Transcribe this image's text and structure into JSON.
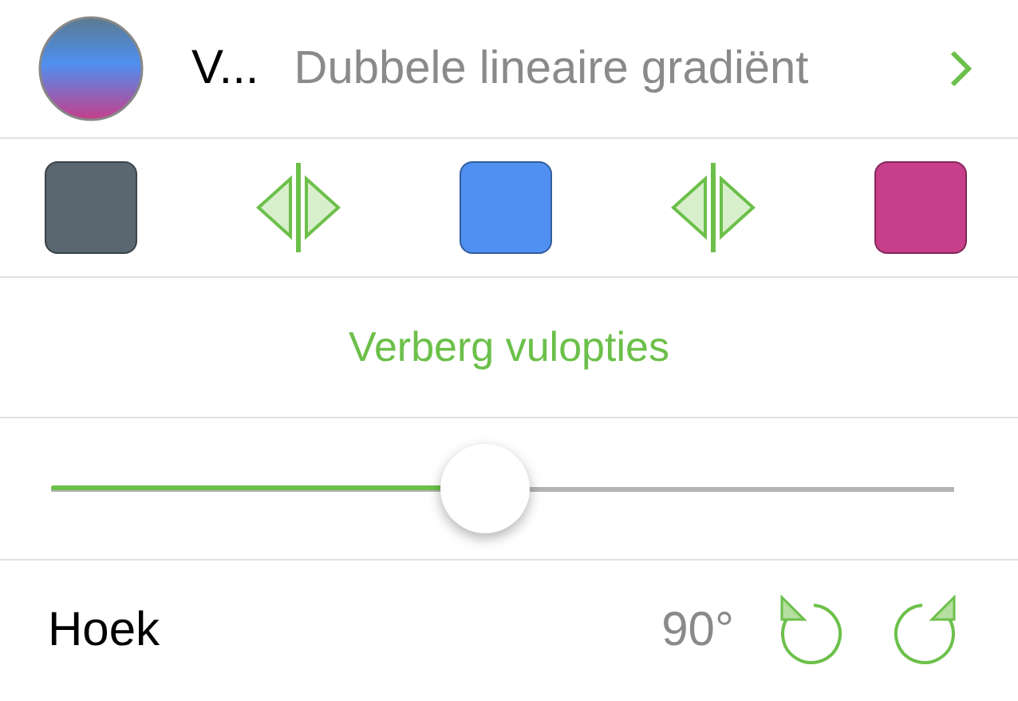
{
  "fill": {
    "name": "V...",
    "type_label": "Dubbele lineaire gradiënt"
  },
  "stops": [
    {
      "color": "#5a6770"
    },
    {
      "color": "#4f90f0"
    },
    {
      "color": "#c73e8a"
    }
  ],
  "toggle_link": "Verberg vulopties",
  "slider": {
    "level": 0.48
  },
  "angle": {
    "label": "Hoek",
    "value": "90°"
  }
}
